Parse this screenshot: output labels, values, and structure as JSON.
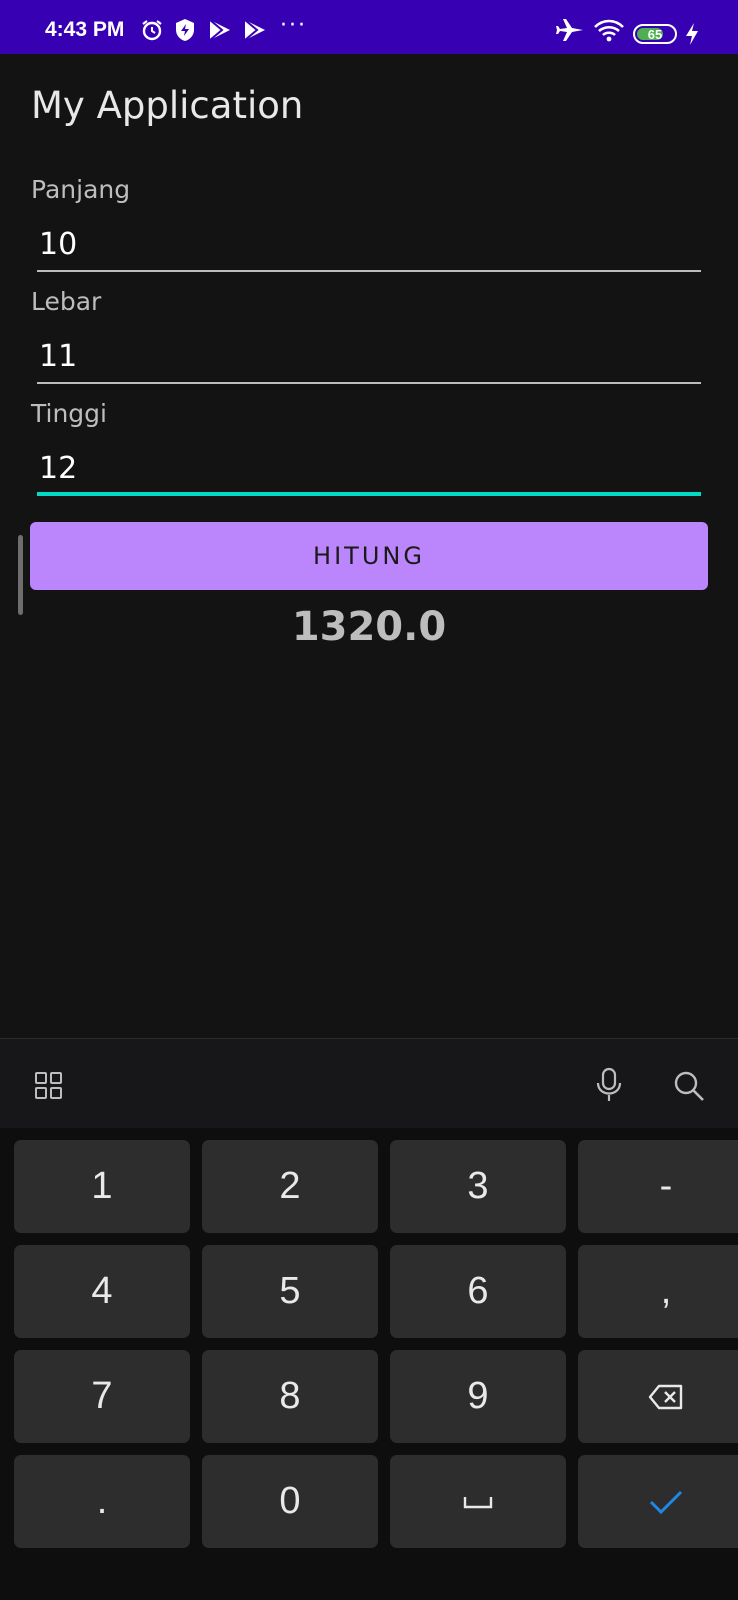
{
  "status_bar": {
    "time": "4:43 PM",
    "battery": "65",
    "icons": [
      "alarm-icon",
      "shield-bolt-icon",
      "play-store-icon",
      "play-store-icon",
      "airplane-icon",
      "wifi-icon",
      "battery-icon",
      "charging-icon"
    ],
    "more": "···"
  },
  "app": {
    "title": "My Application",
    "fields": [
      {
        "label": "Panjang",
        "value": "10"
      },
      {
        "label": "Lebar",
        "value": "11"
      },
      {
        "label": "Tinggi",
        "value": "12"
      }
    ],
    "button_label": "HITUNG",
    "result": "1320.0",
    "colors": {
      "accent": "#bb86fc",
      "focus": "#03dac5",
      "statusbar": "#3700b3",
      "background": "#131313"
    }
  },
  "keyboard": {
    "toolbar_icons": [
      "grid-icon",
      "microphone-icon",
      "search-icon"
    ],
    "rows": [
      [
        "1",
        "2",
        "3",
        "-"
      ],
      [
        "4",
        "5",
        "6",
        ","
      ],
      [
        "7",
        "8",
        "9",
        "backspace"
      ],
      [
        ".",
        "0",
        "space",
        "done"
      ]
    ],
    "labels": {
      "k1": "1",
      "k2": "2",
      "k3": "3",
      "kminus": "-",
      "k4": "4",
      "k5": "5",
      "k6": "6",
      "kcomma": ",",
      "k7": "7",
      "k8": "8",
      "k9": "9",
      "kdot": ".",
      "k0": "0"
    }
  }
}
